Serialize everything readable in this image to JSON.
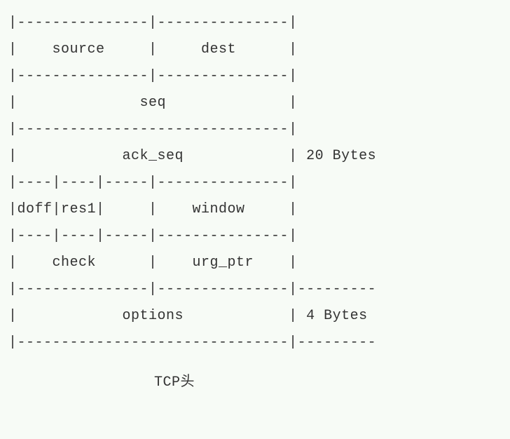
{
  "diagram": {
    "lines": [
      "|---------------|---------------|",
      "|    source     |     dest      |",
      "|---------------|---------------|",
      "|              seq              |",
      "|-------------------------------|",
      "|            ack_seq            | 20 Bytes",
      "|----|----|-----|---------------|",
      "|doff|res1|     |    window     |",
      "|----|----|-----|---------------|",
      "|    check      |    urg_ptr    |",
      "|---------------|---------------|---------",
      "|            options            | 4 Bytes",
      "|-------------------------------|---------"
    ],
    "caption": "TCP头",
    "fields": {
      "source": "source",
      "dest": "dest",
      "seq": "seq",
      "ack_seq": "ack_seq",
      "doff": "doff",
      "res1": "res1",
      "window": "window",
      "check": "check",
      "urg_ptr": "urg_ptr",
      "options": "options"
    },
    "sizes": {
      "main_header": "20 Bytes",
      "options": "4 Bytes"
    }
  }
}
